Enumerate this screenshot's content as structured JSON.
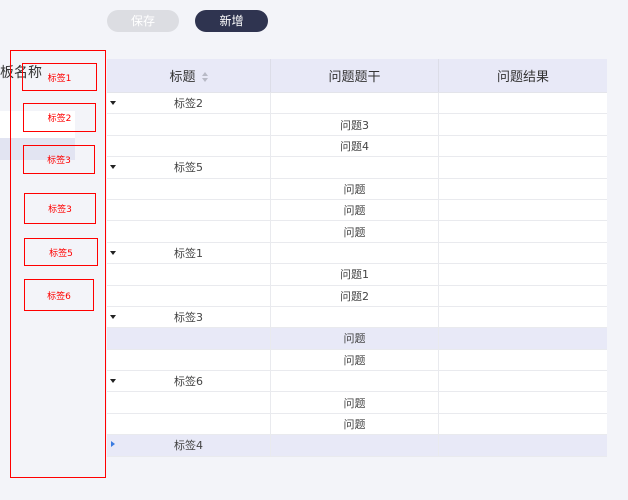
{
  "toolbar": {
    "save_label": "保存",
    "add_label": "新增"
  },
  "left_panel": {
    "title": "板名称"
  },
  "tag_boxes": [
    "标签1",
    "标签2",
    "标签3",
    "标签3",
    "标签5",
    "标签6"
  ],
  "table": {
    "headers": [
      "标题",
      "问题题干",
      "问题结果"
    ],
    "rows": [
      {
        "title": "标签2",
        "question": "",
        "result": "",
        "group": true,
        "expanded": true
      },
      {
        "title": "",
        "question": "问题3",
        "result": ""
      },
      {
        "title": "",
        "question": "问题4",
        "result": ""
      },
      {
        "title": "标签5",
        "question": "",
        "result": "",
        "group": true,
        "expanded": true
      },
      {
        "title": "",
        "question": "问题",
        "result": ""
      },
      {
        "title": "",
        "question": "问题",
        "result": ""
      },
      {
        "title": "",
        "question": "问题",
        "result": ""
      },
      {
        "title": "标签1",
        "question": "",
        "result": "",
        "group": true,
        "expanded": true
      },
      {
        "title": "",
        "question": "问题1",
        "result": ""
      },
      {
        "title": "",
        "question": "问题2",
        "result": ""
      },
      {
        "title": "标签3",
        "question": "",
        "result": "",
        "group": true,
        "expanded": true
      },
      {
        "title": "",
        "question": "问题",
        "result": "",
        "highlighted": true
      },
      {
        "title": "",
        "question": "问题",
        "result": ""
      },
      {
        "title": "标签6",
        "question": "",
        "result": "",
        "group": true,
        "expanded": true
      },
      {
        "title": "",
        "question": "问题",
        "result": ""
      },
      {
        "title": "",
        "question": "问题",
        "result": ""
      },
      {
        "title": "标签4",
        "question": "",
        "result": "",
        "group": true,
        "expanded": false,
        "highlighted": true
      }
    ]
  },
  "colors": {
    "accent_dark": "#2f3450",
    "header_bg": "#e8e9f7",
    "annotation_red": "#ff0000"
  }
}
